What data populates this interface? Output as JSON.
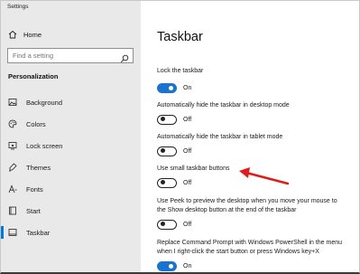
{
  "window": {
    "title": "Settings"
  },
  "sidebar": {
    "home_label": "Home",
    "search_placeholder": "Find a setting",
    "section_heading": "Personalization",
    "items": [
      {
        "label": "Background",
        "icon": "background-icon"
      },
      {
        "label": "Colors",
        "icon": "colors-icon"
      },
      {
        "label": "Lock screen",
        "icon": "lock-screen-icon"
      },
      {
        "label": "Themes",
        "icon": "themes-icon"
      },
      {
        "label": "Fonts",
        "icon": "fonts-icon"
      },
      {
        "label": "Start",
        "icon": "start-icon"
      },
      {
        "label": "Taskbar",
        "icon": "taskbar-icon",
        "active": true
      }
    ]
  },
  "main": {
    "title": "Taskbar",
    "settings": [
      {
        "label": "Lock the taskbar",
        "state": "On"
      },
      {
        "label": "Automatically hide the taskbar in desktop mode",
        "state": "Off"
      },
      {
        "label": "Automatically hide the taskbar in tablet mode",
        "state": "Off"
      },
      {
        "label": "Use small taskbar buttons",
        "state": "Off"
      },
      {
        "label_line1": "Use Peek to preview the desktop when you move your mouse to",
        "label_line2": "the Show desktop button at the end of the taskbar",
        "state": "Off"
      },
      {
        "label_line1": "Replace Command Prompt with Windows PowerShell in the menu",
        "label_line2": "when I right-click the start button or press Windows key+X",
        "state": "On"
      }
    ]
  },
  "colors": {
    "accent": "#0078d7",
    "toggle_on": "#1a73d1",
    "sidebar_bg": "#e9e9e9",
    "annotation_arrow": "#e01b1b"
  }
}
